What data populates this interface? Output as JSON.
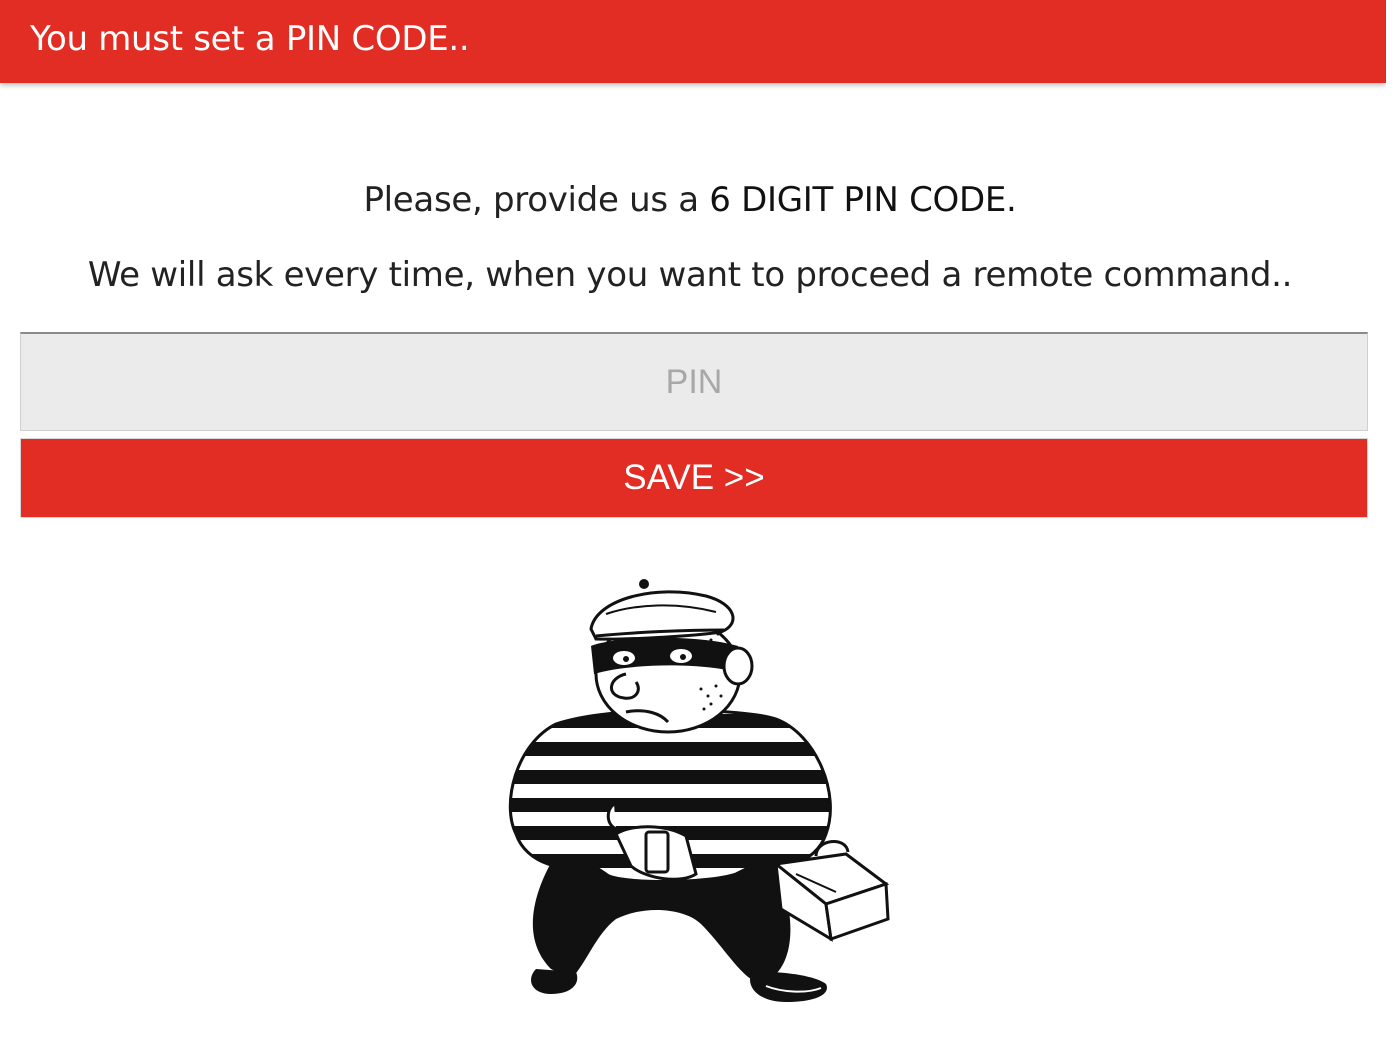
{
  "header": {
    "title": "You must set a PIN CODE.."
  },
  "main": {
    "intro_text": "Please, provide us a ",
    "intro_emphasis": "6 DIGIT PIN CODE.",
    "info_text": "We will ask every time, when you want to proceed a remote command.."
  },
  "form": {
    "pin_placeholder": "PIN",
    "pin_value": "",
    "save_label": "SAVE >>"
  },
  "illustration": {
    "icon": "burglar-illustration"
  },
  "colors": {
    "accent": "#e12d24",
    "input_background": "#ebebeb",
    "text": "#222222"
  }
}
